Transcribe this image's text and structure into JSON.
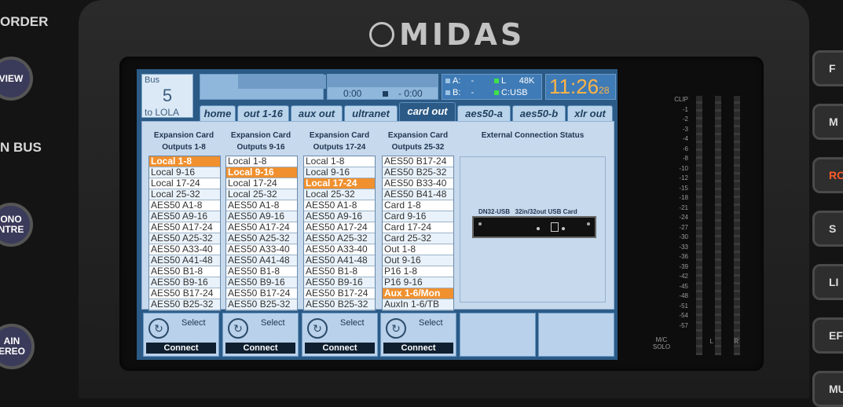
{
  "brand": "MIDAS",
  "left_panel": {
    "labels": [
      "ORDER",
      "N BUS"
    ],
    "buttons": [
      "VIEW",
      "ONO\nNTRE",
      "AIN\nEREO"
    ]
  },
  "right_panel": {
    "buttons": [
      "F",
      "M",
      "RO",
      "S",
      "LI",
      "EF",
      "MU"
    ]
  },
  "screen": {
    "bus": {
      "label": "Bus",
      "number": "5",
      "name": "to LOLA"
    },
    "transport": {
      "time1": "0:00",
      "time2": "- 0:00"
    },
    "io": {
      "a_label": "A:",
      "a_val": "-",
      "b_label": "B:",
      "b_val": "-",
      "l_label": "L",
      "l_val": "48K",
      "c_label": "C:",
      "c_val": "USB"
    },
    "clock": {
      "hhmm": "11:26",
      "sec": "28"
    },
    "tabs": [
      "home",
      "out 1-16",
      "aux out",
      "ultranet",
      "card out",
      "aes50-a",
      "aes50-b",
      "xlr out"
    ],
    "active_tab": "card out",
    "columns": [
      {
        "header": "Expansion Card\nOutputs 1-8",
        "selected": 0,
        "items": [
          "Local 1-8",
          "Local 9-16",
          "Local 17-24",
          "Local 25-32",
          "AES50 A1-8",
          "AES50 A9-16",
          "AES50 A17-24",
          "AES50 A25-32",
          "AES50 A33-40",
          "AES50 A41-48",
          "AES50 B1-8",
          "AES50 B9-16",
          "AES50 B17-24",
          "AES50 B25-32"
        ]
      },
      {
        "header": "Expansion Card\nOutputs 9-16",
        "selected": 1,
        "items": [
          "Local 1-8",
          "Local 9-16",
          "Local 17-24",
          "Local 25-32",
          "AES50 A1-8",
          "AES50 A9-16",
          "AES50 A17-24",
          "AES50 A25-32",
          "AES50 A33-40",
          "AES50 A41-48",
          "AES50 B1-8",
          "AES50 B9-16",
          "AES50 B17-24",
          "AES50 B25-32"
        ]
      },
      {
        "header": "Expansion Card\nOutputs 17-24",
        "selected": 2,
        "items": [
          "Local 1-8",
          "Local 9-16",
          "Local 17-24",
          "Local 25-32",
          "AES50 A1-8",
          "AES50 A9-16",
          "AES50 A17-24",
          "AES50 A25-32",
          "AES50 A33-40",
          "AES50 A41-48",
          "AES50 B1-8",
          "AES50 B9-16",
          "AES50 B17-24",
          "AES50 B25-32"
        ]
      },
      {
        "header": "Expansion Card\nOutputs 25-32",
        "selected": 12,
        "items": [
          "AES50 B17-24",
          "AES50 B25-32",
          "AES50 B33-40",
          "AES50 B41-48",
          "Card 1-8",
          "Card 9-16",
          "Card 17-24",
          "Card 25-32",
          "Out 1-8",
          "Out 9-16",
          "P16 1-8",
          "P16 9-16",
          "Aux 1-6/Mon",
          "AuxIn 1-6/TB"
        ]
      }
    ],
    "external": {
      "title": "External Connection Status",
      "card_label": "DN32-USB   32in/32out USB Card"
    },
    "softkeys": [
      {
        "select": "Select",
        "connect": "Connect"
      },
      {
        "select": "Select",
        "connect": "Connect"
      },
      {
        "select": "Select",
        "connect": "Connect"
      },
      {
        "select": "Select",
        "connect": "Connect"
      },
      {
        "select": "",
        "connect": ""
      },
      {
        "select": "",
        "connect": ""
      }
    ]
  },
  "meter": {
    "labels": [
      "CLIP",
      "-1",
      "-2",
      "-3",
      "-4",
      "-6",
      "-8",
      "-10",
      "-12",
      "-15",
      "-18",
      "-21",
      "-24",
      "-27",
      "-30",
      "-33",
      "-36",
      "-39",
      "-42",
      "-45",
      "-48",
      "-51",
      "-54",
      "-57"
    ],
    "footer": {
      "mc": "M/C\nSOLO",
      "l": "L",
      "r": "R"
    }
  }
}
